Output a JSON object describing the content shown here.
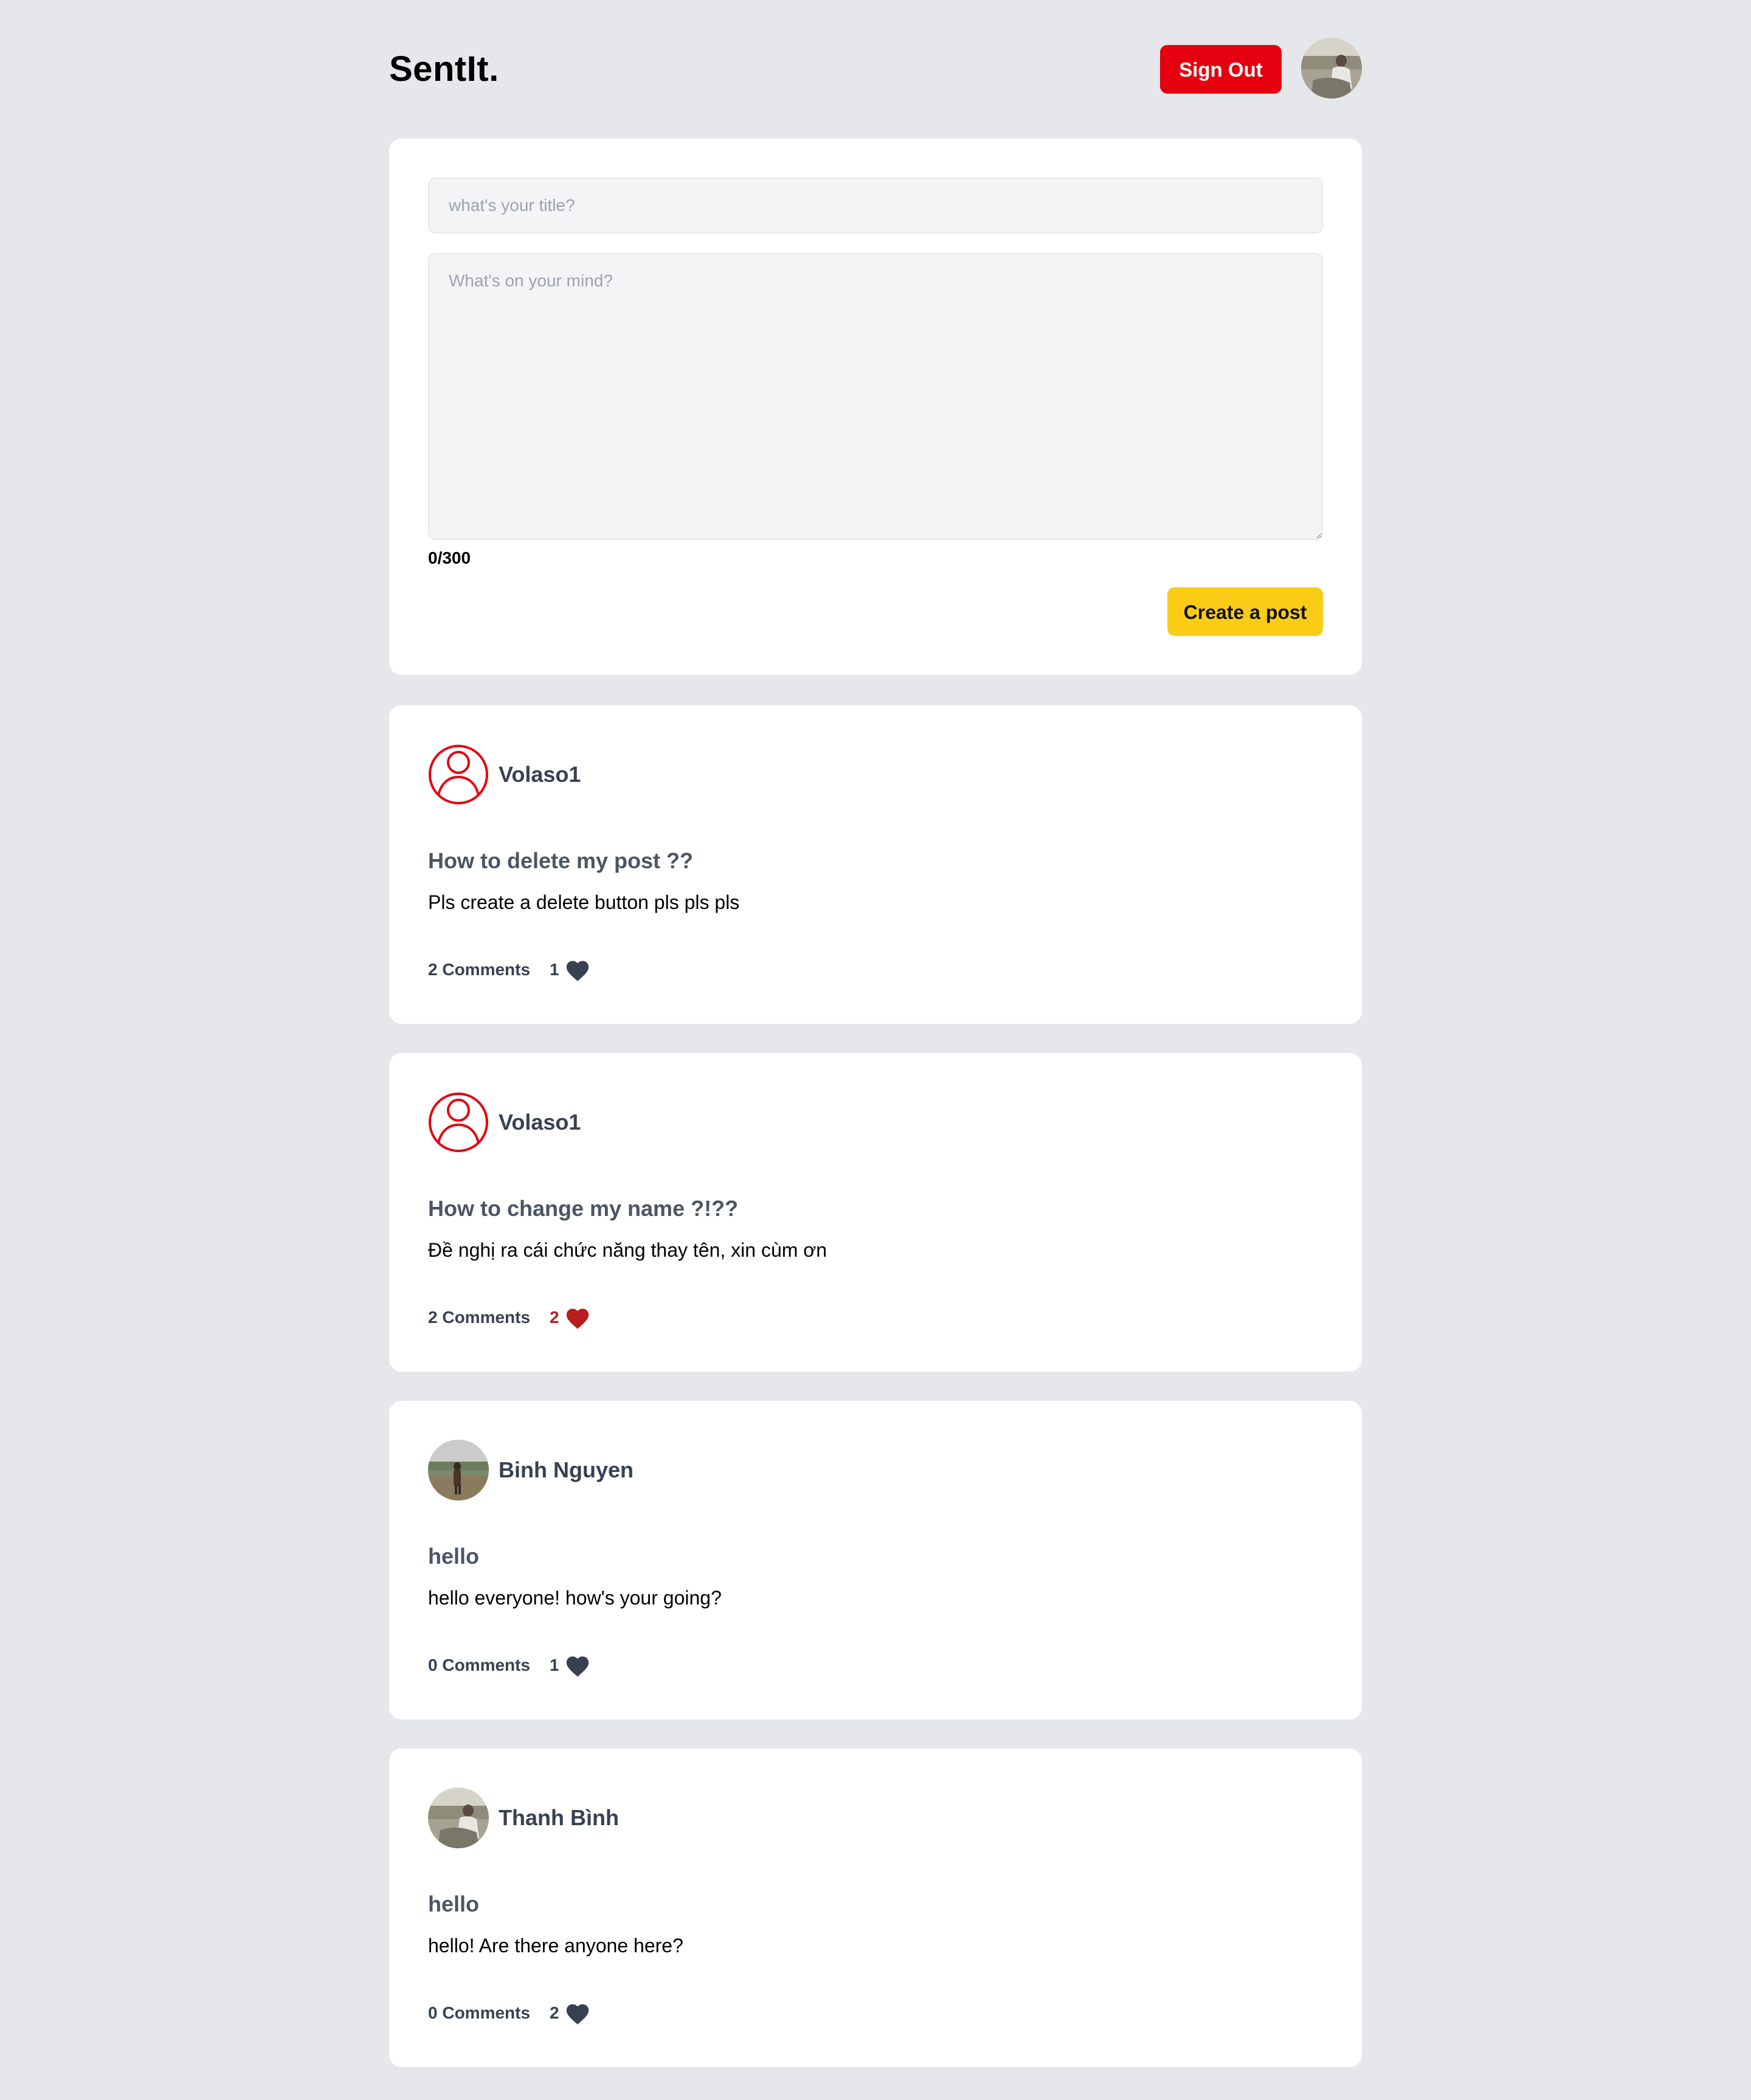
{
  "header": {
    "logo": "SentIt.",
    "signout_label": "Sign Out"
  },
  "composer": {
    "title_placeholder": "what's your title?",
    "body_placeholder": "What's on your mind?",
    "counter": "0/300",
    "create_label": "Create a post"
  },
  "posts": [
    {
      "author": "Volaso1",
      "avatar": "default-user-icon",
      "title": "How to delete my post ??",
      "body": "Pls create a delete button pls pls pls",
      "comments": "2 Comments",
      "likes": "1",
      "liked": false
    },
    {
      "author": "Volaso1",
      "avatar": "default-user-icon",
      "title": "How to change my name ?!??",
      "body": "Đề nghị ra cái chức năng thay tên, xin cùm ơn",
      "comments": "2 Comments",
      "likes": "2",
      "liked": true
    },
    {
      "author": "Binh Nguyen",
      "avatar": "photo",
      "title": "hello",
      "body": "hello everyone! how's your going?",
      "comments": "0 Comments",
      "likes": "1",
      "liked": false
    },
    {
      "author": "Thanh Bình",
      "avatar": "photo",
      "title": "hello",
      "body": "hello! Are there anyone here?",
      "comments": "0 Comments",
      "likes": "2",
      "liked": false
    }
  ],
  "colors": {
    "background": "#e5e7eb",
    "signout": "#e5000f",
    "create_button": "#facc15",
    "liked_heart": "#b91c1c",
    "heart": "#374151"
  }
}
